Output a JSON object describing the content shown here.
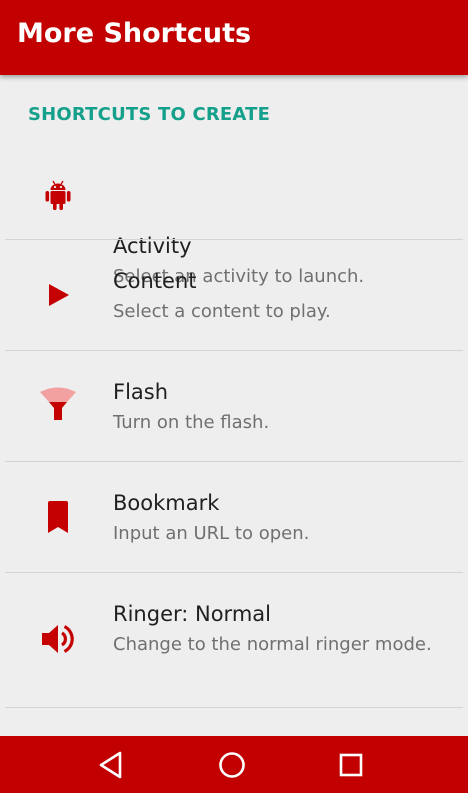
{
  "appbar": {
    "title": "More Shortcuts",
    "color": "#c20000"
  },
  "section": {
    "header": "SHORTCUTS TO CREATE",
    "header_color": "#15a08c"
  },
  "items": [
    {
      "title": "Activity",
      "subtitle": "Select an activity to launch.",
      "icon": "android-icon"
    },
    {
      "title": "Content",
      "subtitle": "Select a content to play.",
      "icon": "play-icon"
    },
    {
      "title": "Flash",
      "subtitle": "Turn on the flash.",
      "icon": "flashlight-icon"
    },
    {
      "title": "Bookmark",
      "subtitle": "Input an URL to open.",
      "icon": "bookmark-icon"
    },
    {
      "title": "Ringer: Normal",
      "subtitle": "Change to the normal ringer mode.",
      "icon": "volume-icon"
    }
  ],
  "icon_color": "#c40000",
  "navbar": {
    "back_icon": "back-triangle-icon",
    "home_icon": "home-circle-icon",
    "recents_icon": "recents-square-icon"
  }
}
